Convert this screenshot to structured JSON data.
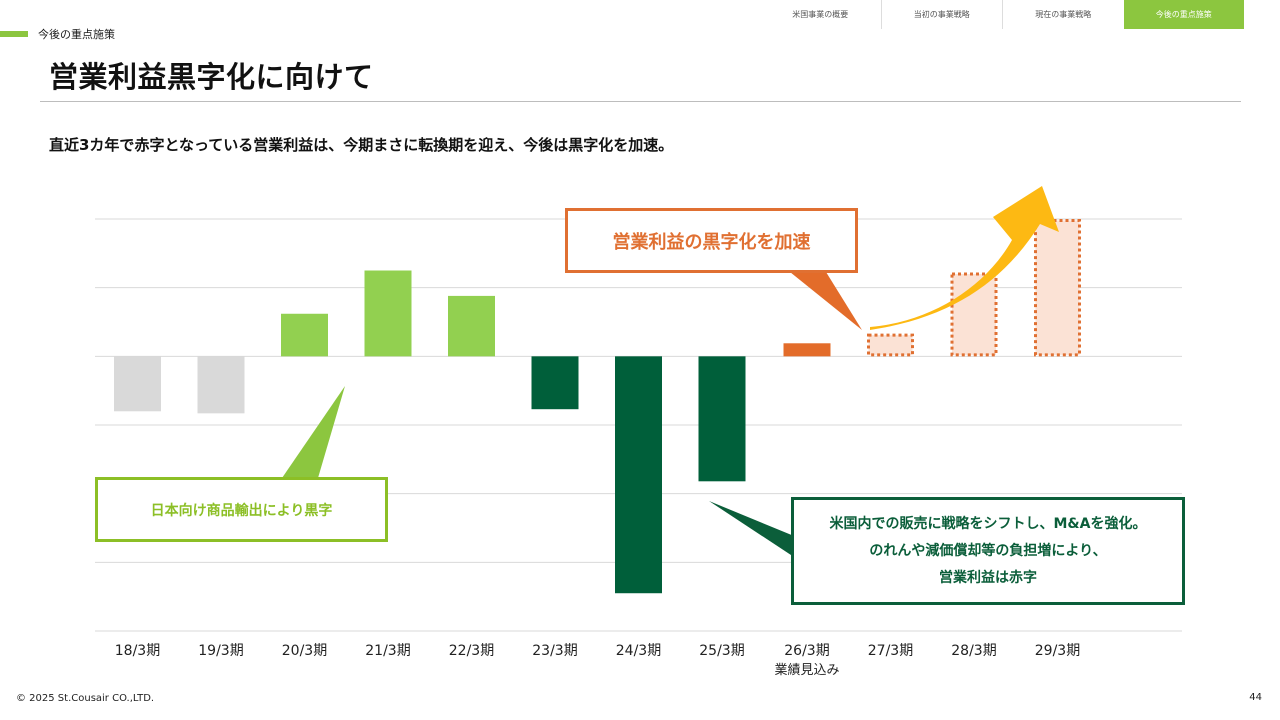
{
  "nav": {
    "tabs": [
      {
        "label": "米国事業の概要",
        "active": false
      },
      {
        "label": "当初の事業戦略",
        "active": false
      },
      {
        "label": "現在の事業戦略",
        "active": false
      },
      {
        "label": "今後の重点施策",
        "active": true
      }
    ]
  },
  "header": {
    "section": "今後の重点施策",
    "title": "営業利益黒字化に向けて",
    "subtitle": "直近3カ年で赤字となっている営業利益は、今期まさに転換期を迎え、今後は黒字化を加速。"
  },
  "callouts": {
    "orange": "営業利益の黒字化を加速",
    "lime": "日本向け商品輸出により黒字",
    "green": [
      "米国内での販売に戦略をシフトし、M&Aを強化。",
      "のれんや減価償却等の負担増により、",
      "営業利益は赤字"
    ]
  },
  "footer": {
    "copyright": "© 2025 St.Cousair CO.,LTD.",
    "page": "44"
  },
  "colors": {
    "negative_early": "#d9d9d9",
    "positive": "#92d050",
    "negative_recent": "#005f3a",
    "forecast": "#e36c2a",
    "projection_fill": "#fbe2d5",
    "projection_border": "#e07032",
    "arrow": "#fdb913",
    "grid": "#d9d9d9"
  },
  "chart_data": {
    "type": "bar",
    "categories": [
      "18/3期",
      "19/3期",
      "20/3期",
      "21/3期",
      "22/3期",
      "23/3期",
      "24/3期",
      "25/3期",
      "26/3期",
      "27/3期",
      "28/3期",
      "29/3期"
    ],
    "category_sublabels": {
      "26/3期": "業績見込み"
    },
    "values": [
      -0.8,
      -0.83,
      0.62,
      1.25,
      0.88,
      -0.77,
      -3.45,
      -1.82,
      0.19,
      0.33,
      1.22,
      2.0
    ],
    "status": [
      "actual",
      "actual",
      "actual",
      "actual",
      "actual",
      "actual",
      "actual",
      "actual",
      "forecast",
      "projection",
      "projection",
      "projection"
    ],
    "ylim": [
      -4,
      2
    ],
    "grid": true,
    "title": "",
    "xlabel": "",
    "ylabel": ""
  }
}
